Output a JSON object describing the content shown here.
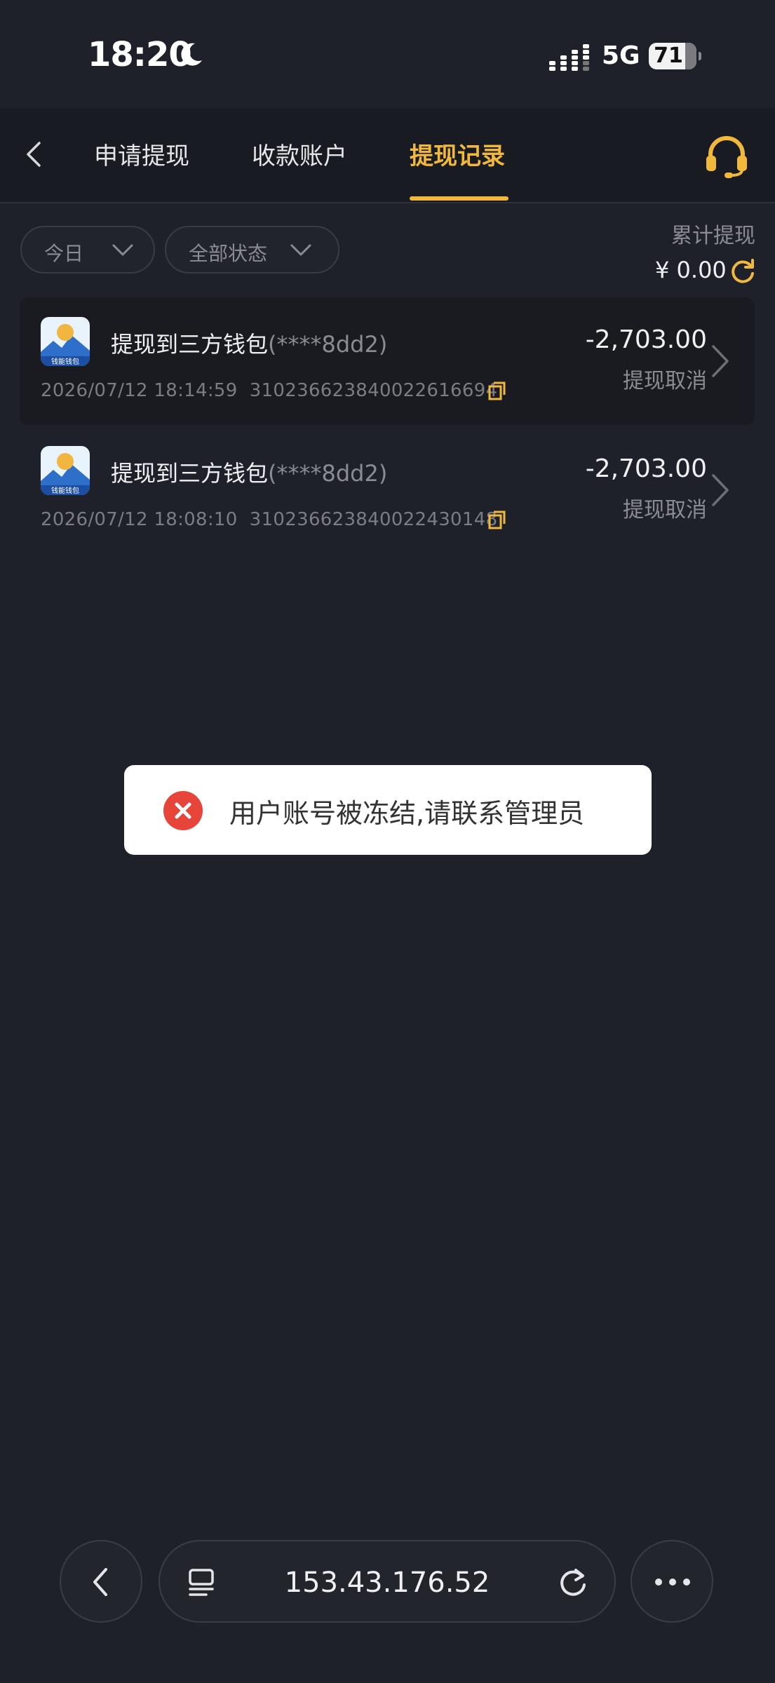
{
  "status_bar": {
    "time": "18:20",
    "network": "5G",
    "battery": "71"
  },
  "header": {
    "tabs": [
      {
        "label": "申请提现"
      },
      {
        "label": "收款账户"
      },
      {
        "label": "提现记录"
      }
    ],
    "active_tab": "提现记录"
  },
  "filters": {
    "date": "今日",
    "status": "全部状态"
  },
  "total": {
    "label": "累计提现",
    "value": "¥ 0.00"
  },
  "records": [
    {
      "title": "提现到三方钱包",
      "account": "(****8dd2)",
      "datetime": "2026/07/12 18:14:59",
      "order_id": "310236623840022616694",
      "amount": "-2,703.00",
      "status": "提现取消",
      "logo_text": "钱能钱包"
    },
    {
      "title": "提现到三方钱包",
      "account": "(****8dd2)",
      "datetime": "2026/07/12 18:08:10",
      "order_id": "310236623840022430148",
      "amount": "-2,703.00",
      "status": "提现取消",
      "logo_text": "钱能钱包"
    }
  ],
  "toast": {
    "message": "用户账号被冻结,请联系管理员"
  },
  "browser_bar": {
    "url": "153.43.176.52"
  },
  "colors": {
    "accent": "#f1b83b",
    "background": "#1f212a",
    "error": "#e7443a"
  }
}
